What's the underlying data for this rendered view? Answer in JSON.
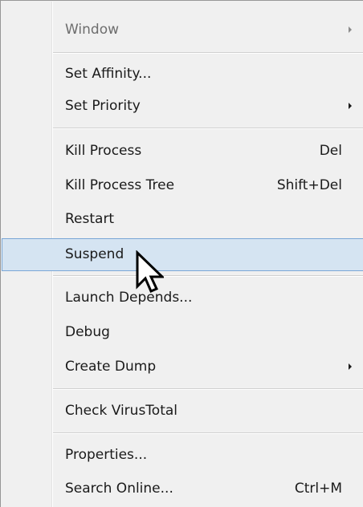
{
  "menu": {
    "items": [
      {
        "label": "Window",
        "shortcut": "",
        "submenu": true,
        "enabled": false
      },
      {
        "label": "Set Affinity...",
        "shortcut": "",
        "submenu": false,
        "enabled": true
      },
      {
        "label": "Set Priority",
        "shortcut": "",
        "submenu": true,
        "enabled": true
      },
      {
        "label": "Kill Process",
        "shortcut": "Del",
        "submenu": false,
        "enabled": true
      },
      {
        "label": "Kill Process Tree",
        "shortcut": "Shift+Del",
        "submenu": false,
        "enabled": true
      },
      {
        "label": "Restart",
        "shortcut": "",
        "submenu": false,
        "enabled": true
      },
      {
        "label": "Suspend",
        "shortcut": "",
        "submenu": false,
        "enabled": true,
        "highlighted": true
      },
      {
        "label": "Launch Depends...",
        "shortcut": "",
        "submenu": false,
        "enabled": true
      },
      {
        "label": "Debug",
        "shortcut": "",
        "submenu": false,
        "enabled": true
      },
      {
        "label": "Create Dump",
        "shortcut": "",
        "submenu": true,
        "enabled": true
      },
      {
        "label": "Check VirusTotal",
        "shortcut": "",
        "submenu": false,
        "enabled": true
      },
      {
        "label": "Properties...",
        "shortcut": "",
        "submenu": false,
        "enabled": true
      },
      {
        "label": "Search Online...",
        "shortcut": "Ctrl+M",
        "submenu": false,
        "enabled": true
      }
    ]
  },
  "colors": {
    "menu_background": "#f0f0f0",
    "highlight_background": "#d5e4f2",
    "highlight_border": "#7aa7d6",
    "disabled_text": "#6d6d6d"
  },
  "cursor": {
    "icon": "arrow-pointer-icon"
  }
}
